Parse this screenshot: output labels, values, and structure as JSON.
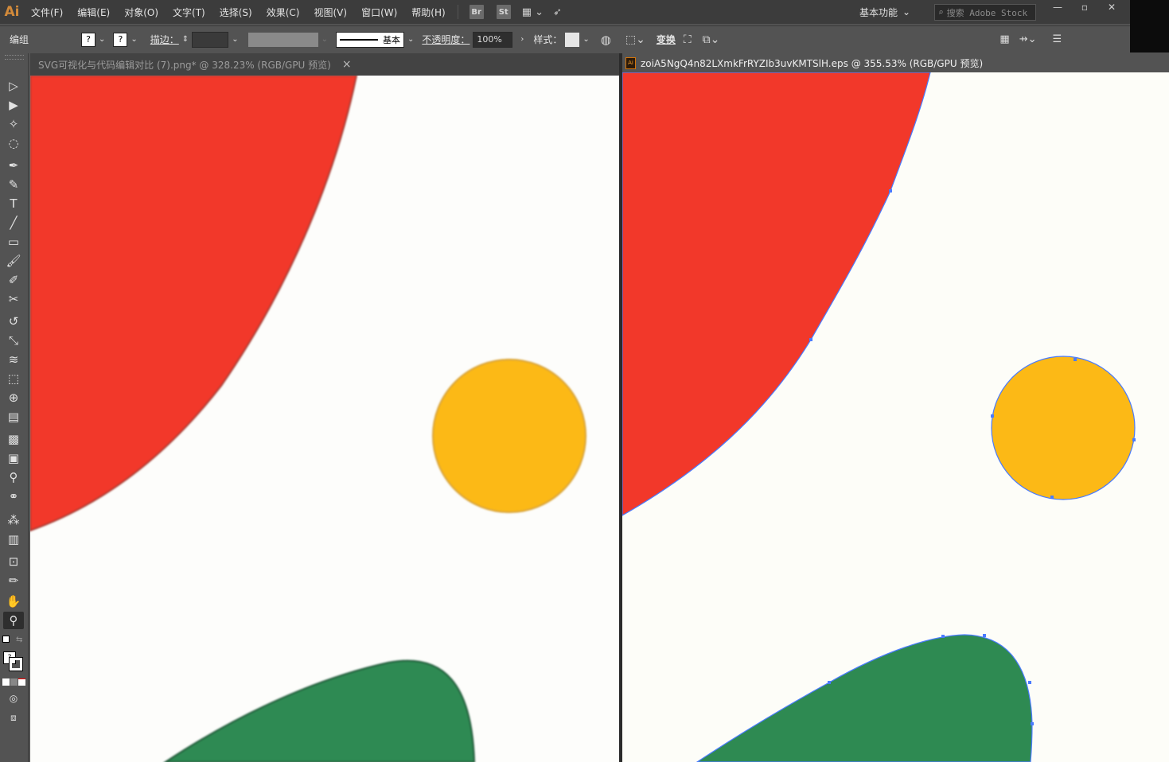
{
  "app": {
    "logo": "Ai"
  },
  "menu": [
    "文件(F)",
    "编辑(E)",
    "对象(O)",
    "文字(T)",
    "选择(S)",
    "效果(C)",
    "视图(V)",
    "窗口(W)",
    "帮助(H)"
  ],
  "menubar_icons": {
    "bridge": "Br",
    "stock": "St",
    "arrange": "arrange-documents-icon",
    "sync": "gpu-performance-icon"
  },
  "workspace": {
    "label": "基本功能"
  },
  "search": {
    "placeholder": "搜索 Adobe Stock"
  },
  "window_controls": {
    "minimize": "—",
    "restore": "▫",
    "close": "✕"
  },
  "controlbar": {
    "selection_label": "编组",
    "fill_swatch": "?",
    "stroke_swatch": "?",
    "stroke_label": "描边：",
    "brush_label": "基本",
    "opacity_label": "不透明度：",
    "opacity_value": "100%",
    "style_label": "样式：",
    "transform_label": "变换"
  },
  "tabs": {
    "left": {
      "title": "SVG可视化与代码编辑对比 (7).png* @ 328.23% (RGB/GPU 预览)",
      "close": "×"
    },
    "right": {
      "title": "zoiA5NgQ4n82LXmkFrRYZIb3uvKMTSlH.eps  @  355.53% (RGB/GPU 预览)",
      "icon": "Ai"
    }
  },
  "tools": [
    "selection-tool",
    "direct-selection-tool",
    "magic-wand-tool",
    "lasso-tool",
    "pen-tool",
    "curvature-tool",
    "type-tool",
    "line-tool",
    "rectangle-tool",
    "paintbrush-tool",
    "shaper-tool",
    "scissors-tool",
    "rotate-tool",
    "scale-tool",
    "warp-tool",
    "free-transform-tool",
    "shape-builder-tool",
    "perspective-grid-tool",
    "mesh-tool",
    "gradient-tool",
    "eyedropper-tool",
    "blend-tool",
    "symbol-sprayer-tool",
    "column-graph-tool",
    "artboard-tool",
    "slice-tool",
    "hand-tool",
    "zoom-tool"
  ],
  "colors": {
    "red": "#f2382a",
    "yellow": "#fcb916",
    "green": "#2e8a52",
    "path_selection": "#4a7bff"
  }
}
